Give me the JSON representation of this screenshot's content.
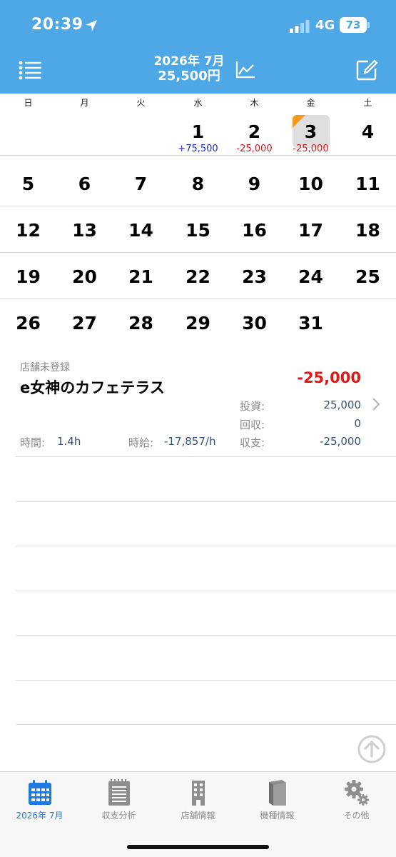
{
  "status_bar": {
    "time": "20:39",
    "network": "4G",
    "battery": "73"
  },
  "header": {
    "month": "2026年 7月",
    "total": "25,500円"
  },
  "weekdays": [
    "日",
    "月",
    "火",
    "水",
    "木",
    "金",
    "土"
  ],
  "calendar": {
    "today": "3",
    "weeks": [
      [
        "",
        "",
        "",
        "1",
        "2",
        "3",
        "4"
      ],
      [
        "5",
        "6",
        "7",
        "8",
        "9",
        "10",
        "11"
      ],
      [
        "12",
        "13",
        "14",
        "15",
        "16",
        "17",
        "18"
      ],
      [
        "19",
        "20",
        "21",
        "22",
        "23",
        "24",
        "25"
      ],
      [
        "26",
        "27",
        "28",
        "29",
        "30",
        "31",
        ""
      ]
    ],
    "amounts": {
      "1": "+75,500",
      "2": "-25,000",
      "3": "-25,000"
    }
  },
  "entry": {
    "store": "店舗未登録",
    "name": "e女神のカフェテラス",
    "balance": "-25,000",
    "invest_label": "投資:",
    "invest": "25,000",
    "return_label": "回収:",
    "return": "0",
    "net_label": "収支:",
    "net": "-25,000",
    "time_label": "時間:",
    "time": "1.4h",
    "rate_label": "時給:",
    "rate": "-17,857/h"
  },
  "tabs": [
    {
      "label": "2026年 7月",
      "icon": "calendar-icon",
      "active": true
    },
    {
      "label": "収支分析",
      "icon": "notepad-icon",
      "active": false
    },
    {
      "label": "店舗情報",
      "icon": "building-icon",
      "active": false
    },
    {
      "label": "機種情報",
      "icon": "book-icon",
      "active": false
    },
    {
      "label": "その他",
      "icon": "gear-icon",
      "active": false
    }
  ],
  "colors": {
    "header": "#4fa8e6",
    "accent": "#1f7ae0",
    "negative": "#e01818",
    "positive": "#1b2fd2",
    "today_flag": "#f39a1c"
  }
}
